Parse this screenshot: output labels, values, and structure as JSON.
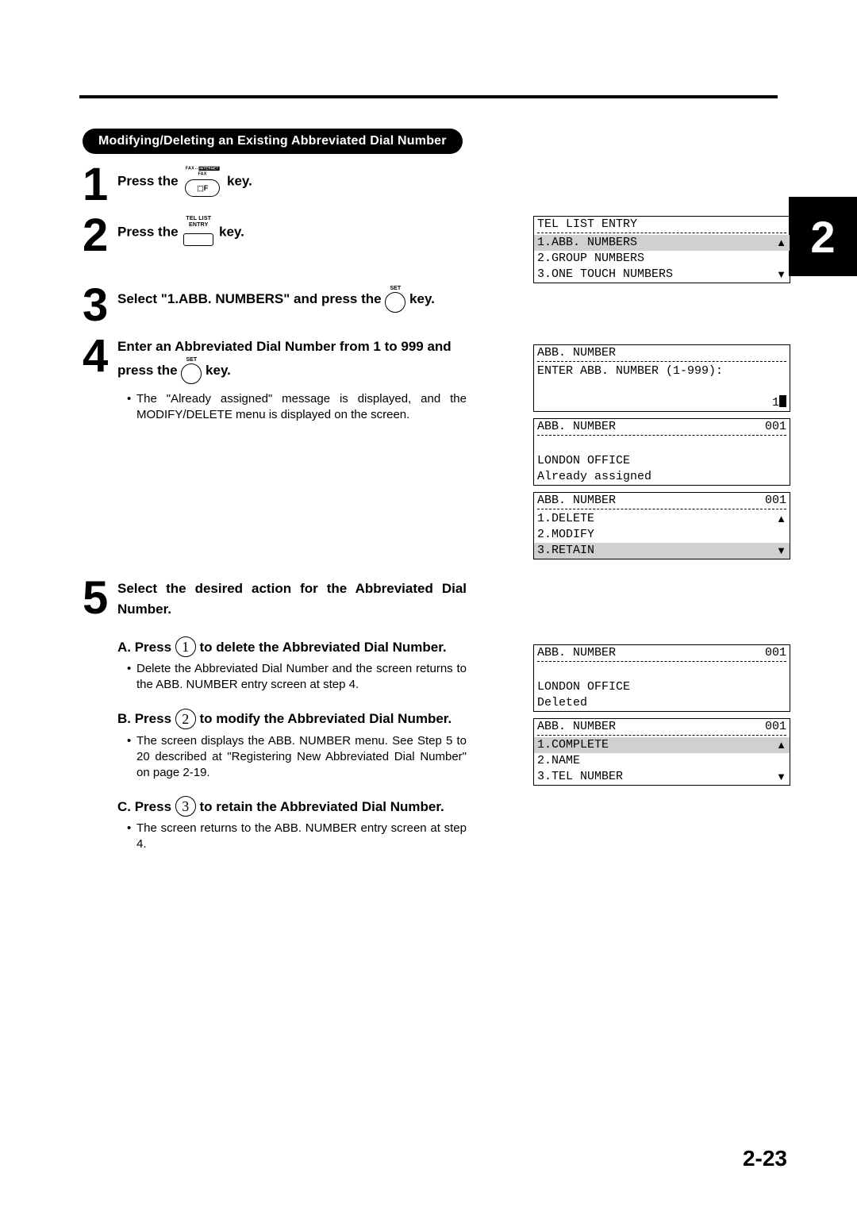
{
  "side_tab": "2",
  "page_number": "2-23",
  "heading_pill": "Modifying/Deleting an Existing Abbreviated Dial Number",
  "keys": {
    "fax_top_label": "FAX↔INTERNET FAX",
    "tel_list_top_label": "TEL LIST",
    "tel_list_mid_label": "ENTRY",
    "set_label": "SET"
  },
  "steps": {
    "s1": {
      "num": "1",
      "pre": "Press the ",
      "post": " key."
    },
    "s2": {
      "num": "2",
      "pre": "Press the ",
      "post": " key."
    },
    "s3": {
      "num": "3",
      "pre": "Select \"1.ABB. NUMBERS\" and press the ",
      "post": " key."
    },
    "s4": {
      "num": "4",
      "line1_pre": "Enter an Abbreviated Dial Number from 1 to 999 and press the ",
      "line1_post": " key.",
      "bullet1": "The \"Already assigned\" message is displayed, and the MODIFY/DELETE menu is displayed on the screen."
    },
    "s5": {
      "num": "5",
      "line": "Select the desired action for the Abbreviated Dial Number.",
      "A_pre": "A.  Press ",
      "A_key": "1",
      "A_post": " to delete the Abbreviated Dial Number.",
      "A_bullet": "Delete the Abbreviated Dial Number and the screen returns to the ABB. NUMBER entry screen at step 4.",
      "B_pre": "B.  Press ",
      "B_key": "2",
      "B_post": " to modify the Abbreviated Dial Number.",
      "B_bullet": "The screen displays the ABB. NUMBER menu.  See Step 5 to 20 described at \"Registering New Abbreviated Dial Number\" on page 2-19.",
      "C_pre": "C.  Press ",
      "C_key": "3",
      "C_post": " to retain the Abbreviated Dial Number.",
      "C_bullet": "The screen returns to the ABB. NUMBER entry screen at step 4."
    }
  },
  "lcd": {
    "tel_list": {
      "title": "TEL LIST ENTRY",
      "r1": "1.ABB. NUMBERS",
      "r2": "2.GROUP NUMBERS",
      "r3": "3.ONE TOUCH NUMBERS"
    },
    "abb_entry": {
      "title": "ABB. NUMBER",
      "r1": "ENTER ABB. NUMBER (1-999):",
      "val": "1"
    },
    "assigned": {
      "title": "ABB. NUMBER",
      "id": "001",
      "r2": "LONDON OFFICE",
      "r3": "Already assigned"
    },
    "menu": {
      "title": "ABB. NUMBER",
      "id": "001",
      "r1": "1.DELETE",
      "r2": "2.MODIFY",
      "r3": "3.RETAIN"
    },
    "deleted": {
      "title": "ABB. NUMBER",
      "id": "001",
      "r2": "LONDON OFFICE",
      "r3": "Deleted"
    },
    "modify": {
      "title": "ABB. NUMBER",
      "id": "001",
      "r1": "1.COMPLETE",
      "r2": "2.NAME",
      "r3": "3.TEL NUMBER"
    }
  }
}
